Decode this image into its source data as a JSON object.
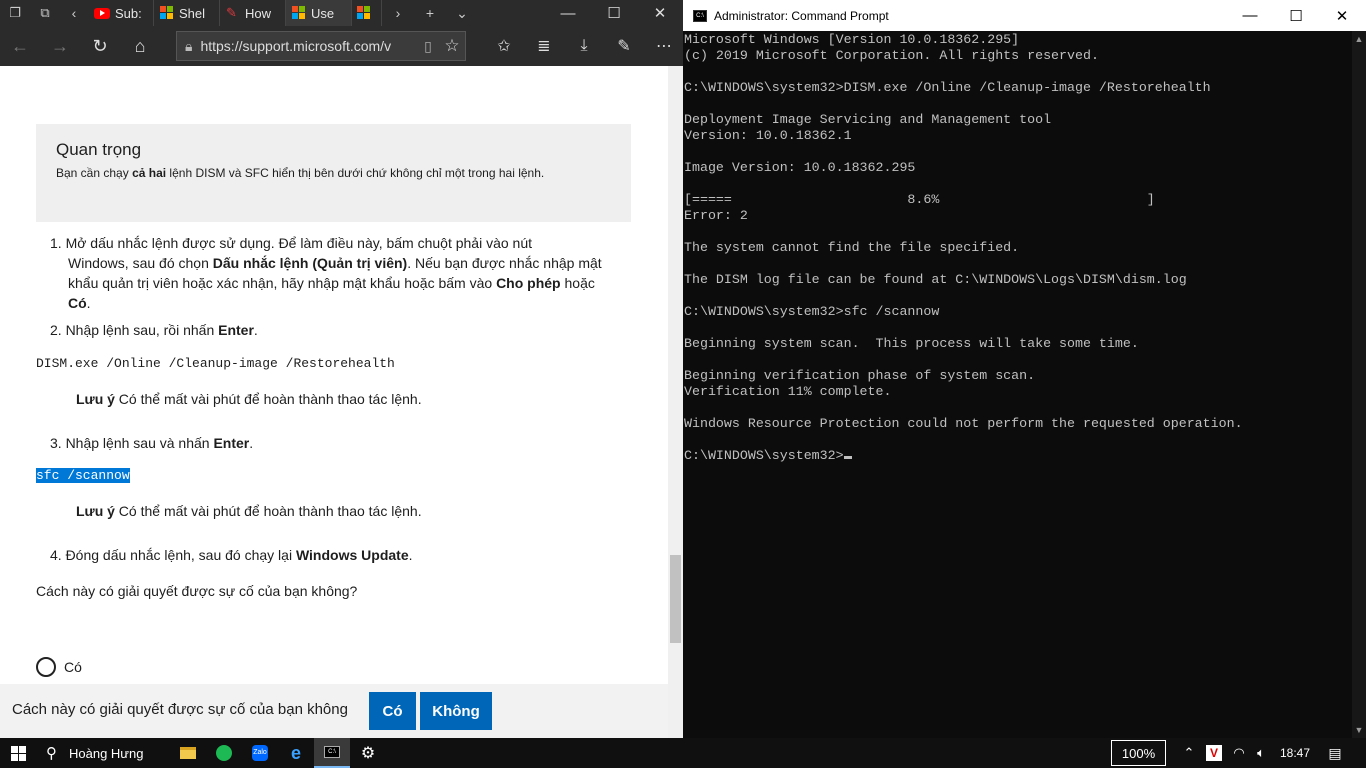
{
  "browser": {
    "tabs": [
      {
        "label": "Sub:",
        "icon": "youtube-icon"
      },
      {
        "label": "Shel",
        "icon": "microsoft-logo-icon"
      },
      {
        "label": "How",
        "icon": "pen-icon"
      },
      {
        "label": "Use",
        "icon": "microsoft-logo-icon"
      },
      {
        "label": "",
        "icon": "microsoft-logo-icon"
      }
    ],
    "address_url": "https://support.microsoft.com/v",
    "important_title": "Quan trọng",
    "important_text_pre": "Bạn cần chạy ",
    "important_text_bold": "cả hai",
    "important_text_post": " lệnh DISM và SFC hiển thị bên dưới chứ không chỉ một trong hai lệnh.",
    "step1_a": "1.  Mở dấu nhắc lệnh được sử dụng. Để làm điều này, bấm chuột phải vào nút",
    "step1_b_pre": "Windows, sau đó chọn ",
    "step1_b_bold": "Dấu nhắc lệnh (Quản trị viên)",
    "step1_b_post": ". Nếu bạn được nhắc nhập mật",
    "step1_c_pre": "khẩu quản trị viên hoặc xác nhận, hãy nhập mật khẩu hoặc bấm vào ",
    "step1_c_bold": "Cho phép",
    "step1_c_post": " hoặc",
    "step1_d_bold": "Có",
    "step1_d_post": ".",
    "step2_pre": "2.  Nhập lệnh sau, rồi nhấn ",
    "step2_bold": "Enter",
    "step2_post": ".",
    "code1": "DISM.exe /Online /Cleanup-image /Restorehealth",
    "note_bold": "Lưu ý",
    "note_text": " Có thể mất vài phút để hoàn thành thao tác lệnh.",
    "step3_pre": "3.  Nhập lệnh sau và nhấn ",
    "step3_bold": "Enter",
    "step3_post": ".",
    "code2": "sfc /scannow",
    "step4_pre": "4.  Đóng dấu nhắc lệnh, sau đó chạy lại ",
    "step4_bold": "Windows Update",
    "step4_post": ".",
    "question": "Cách này có giải quyết được sự cố của bạn không?",
    "radio_yes": "Có",
    "feedback_question": "Cách này có giải quyết được sự cố của bạn không",
    "feedback_yes": "Có",
    "feedback_no": "Không"
  },
  "cmd": {
    "title": "Administrator: Command Prompt",
    "lines": [
      "Microsoft Windows [Version 10.0.18362.295]",
      "(c) 2019 Microsoft Corporation. All rights reserved.",
      "",
      "C:\\WINDOWS\\system32>DISM.exe /Online /Cleanup-image /Restorehealth",
      "",
      "Deployment Image Servicing and Management tool",
      "Version: 10.0.18362.1",
      "",
      "Image Version: 10.0.18362.295",
      "",
      "[=====                      8.6%                          ]",
      "Error: 2",
      "",
      "The system cannot find the file specified.",
      "",
      "The DISM log file can be found at C:\\WINDOWS\\Logs\\DISM\\dism.log",
      "",
      "C:\\WINDOWS\\system32>sfc /scannow",
      "",
      "Beginning system scan.  This process will take some time.",
      "",
      "Beginning verification phase of system scan.",
      "Verification 11% complete.",
      "",
      "Windows Resource Protection could not perform the requested operation.",
      "",
      "C:\\WINDOWS\\system32>"
    ]
  },
  "taskbar": {
    "search_user": "Hoàng Hưng",
    "zoom": "100%",
    "time": "18:47",
    "colors": {
      "accent": "#0067b8",
      "spotify": "#1db954",
      "zalo": "#0068ff",
      "edge": "#0078d7"
    }
  }
}
